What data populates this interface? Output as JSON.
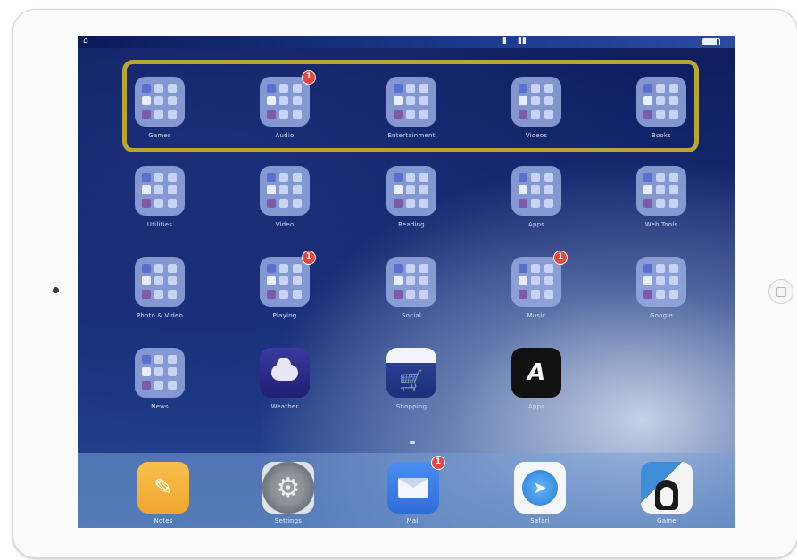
{
  "status_bar": {
    "lock_icon": "lock-icon",
    "battery_percent": 85
  },
  "highlight_color": "#b8a630",
  "badge_color": "#e8453c",
  "home_rows": [
    [
      {
        "label": "Games",
        "kind": "folder",
        "badge": ""
      },
      {
        "label": "Audio",
        "kind": "folder",
        "badge": "1"
      },
      {
        "label": "Entertainment",
        "kind": "folder",
        "badge": ""
      },
      {
        "label": "Videos",
        "kind": "folder",
        "badge": ""
      },
      {
        "label": "Books",
        "kind": "folder",
        "badge": ""
      }
    ],
    [
      {
        "label": "Utilities",
        "kind": "folder",
        "badge": ""
      },
      {
        "label": "Video",
        "kind": "folder",
        "badge": ""
      },
      {
        "label": "Reading",
        "kind": "folder",
        "badge": ""
      },
      {
        "label": "Apps",
        "kind": "folder",
        "badge": ""
      },
      {
        "label": "Web Tools",
        "kind": "folder",
        "badge": ""
      }
    ],
    [
      {
        "label": "Photo & Video",
        "kind": "folder",
        "badge": ""
      },
      {
        "label": "Playing",
        "kind": "folder",
        "badge": "1"
      },
      {
        "label": "Social",
        "kind": "folder",
        "badge": ""
      },
      {
        "label": "Music",
        "kind": "folder",
        "badge": "1"
      },
      {
        "label": "Google",
        "kind": "folder",
        "badge": ""
      }
    ],
    [
      {
        "label": "News",
        "kind": "folder",
        "badge": ""
      },
      {
        "label": "Weather",
        "kind": "cloud",
        "badge": ""
      },
      {
        "label": "Shopping",
        "kind": "cart",
        "badge": ""
      },
      {
        "label": "Apps",
        "kind": "dark",
        "badge": ""
      }
    ]
  ],
  "dock_apps": [
    {
      "label": "Notes",
      "kind": "notes",
      "badge": ""
    },
    {
      "label": "Settings",
      "kind": "gear",
      "badge": ""
    },
    {
      "label": "Mail",
      "kind": "mail",
      "badge": "1"
    },
    {
      "label": "Safari",
      "kind": "safari",
      "badge": ""
    },
    {
      "label": "Game",
      "kind": "game",
      "badge": ""
    }
  ],
  "glyphs": {
    "cart": "🛒",
    "dark_letter": "A",
    "notes": "✎",
    "gear": "⚙",
    "compass": "➤"
  }
}
